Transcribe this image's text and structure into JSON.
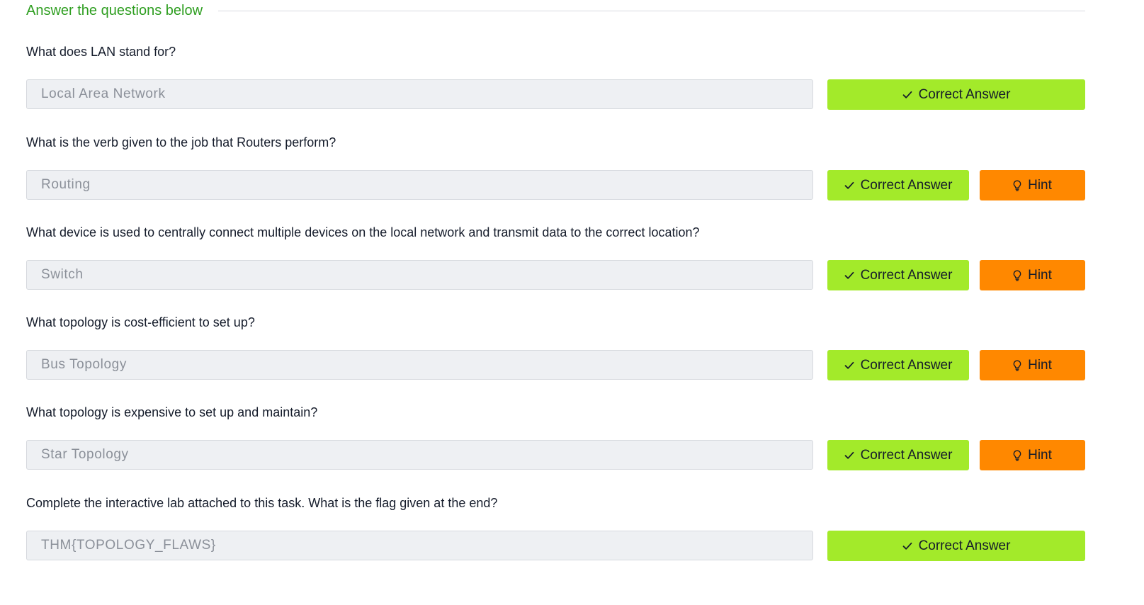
{
  "header": {
    "title": "Answer the questions below"
  },
  "questions": [
    {
      "text": "What does LAN stand for?",
      "answer": "Local Area Network",
      "correct_label": "Correct Answer",
      "hint_label": null
    },
    {
      "text": "What is the verb given to the job that Routers perform?",
      "answer": "Routing",
      "correct_label": "Correct Answer",
      "hint_label": "Hint"
    },
    {
      "text": "What device is used to centrally connect multiple devices on the local network and transmit data to the correct location?",
      "answer": "Switch",
      "correct_label": "Correct Answer",
      "hint_label": "Hint"
    },
    {
      "text": "What topology is cost-efficient to set up?",
      "answer": "Bus Topology",
      "correct_label": "Correct Answer",
      "hint_label": "Hint"
    },
    {
      "text": "What topology is expensive to set up and maintain?",
      "answer": "Star Topology",
      "correct_label": "Correct Answer",
      "hint_label": "Hint"
    },
    {
      "text": "Complete the interactive lab attached to this task. What is the flag given at the end?",
      "answer": "THM{TOPOLOGY_FLAWS}",
      "correct_label": "Correct Answer",
      "hint_label": null
    }
  ],
  "icons": {
    "correct": "check-icon",
    "hint": "lightbulb-icon"
  },
  "colors": {
    "header_green": "#2e9e20",
    "correct_bg": "#a3ea2a",
    "hint_bg": "#ff8800",
    "input_bg": "#eef0f3"
  }
}
